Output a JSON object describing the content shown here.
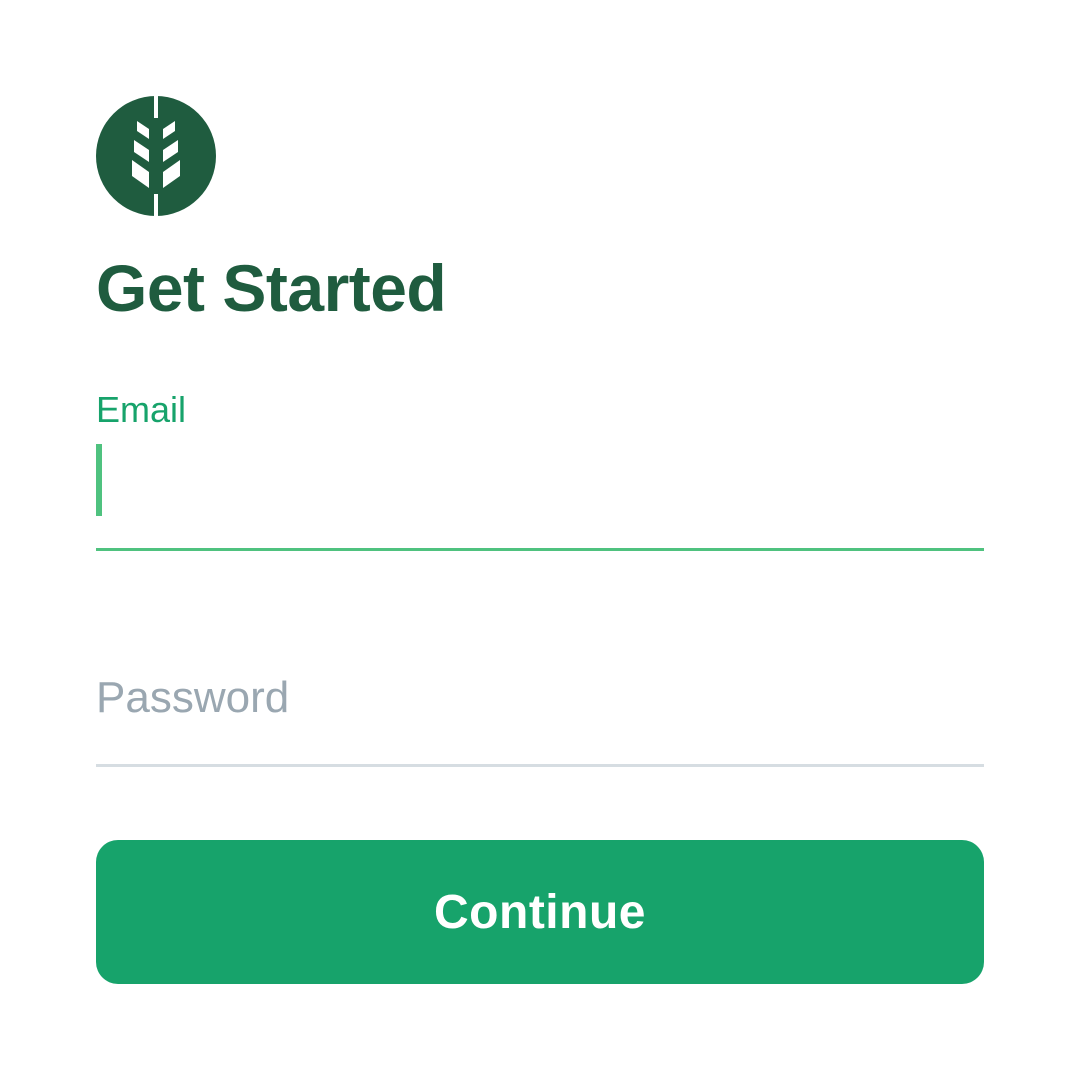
{
  "logo": {
    "icon": "wheat-icon",
    "background_color": "#1f5c3f",
    "foreground_color": "#ffffff"
  },
  "title": "Get Started",
  "email_field": {
    "label": "Email",
    "value": "",
    "state": "focused",
    "accent_color": "#4fc27f"
  },
  "password_field": {
    "placeholder": "Password",
    "value": ""
  },
  "continue_button": {
    "label": "Continue",
    "color": "#17a36b"
  },
  "colors": {
    "title": "#1f5c3f",
    "label_active": "#17a36b",
    "placeholder": "#9aa7b1",
    "divider": "#d6dde2"
  }
}
